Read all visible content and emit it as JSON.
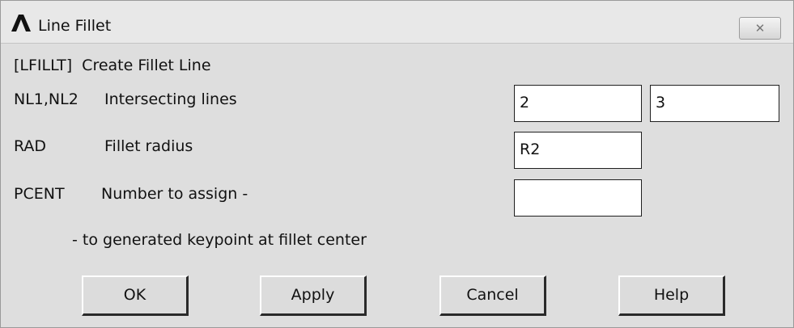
{
  "window": {
    "title": "Line Fillet",
    "close_icon": "close-icon",
    "app_icon": "ansys-logo-icon"
  },
  "form": {
    "command": "[LFILLT]  Create Fillet Line",
    "rows": [
      {
        "key": "NL1,NL2",
        "desc": "Intersecting lines",
        "values": [
          "2",
          "3"
        ]
      },
      {
        "key": "RAD",
        "desc": "Fillet radius",
        "values": [
          "R2"
        ]
      },
      {
        "key": "PCENT",
        "desc": "Number to assign -",
        "values": [
          ""
        ]
      }
    ],
    "note": "- to generated keypoint at fillet center"
  },
  "buttons": {
    "ok": "OK",
    "apply": "Apply",
    "cancel": "Cancel",
    "help": "Help"
  }
}
